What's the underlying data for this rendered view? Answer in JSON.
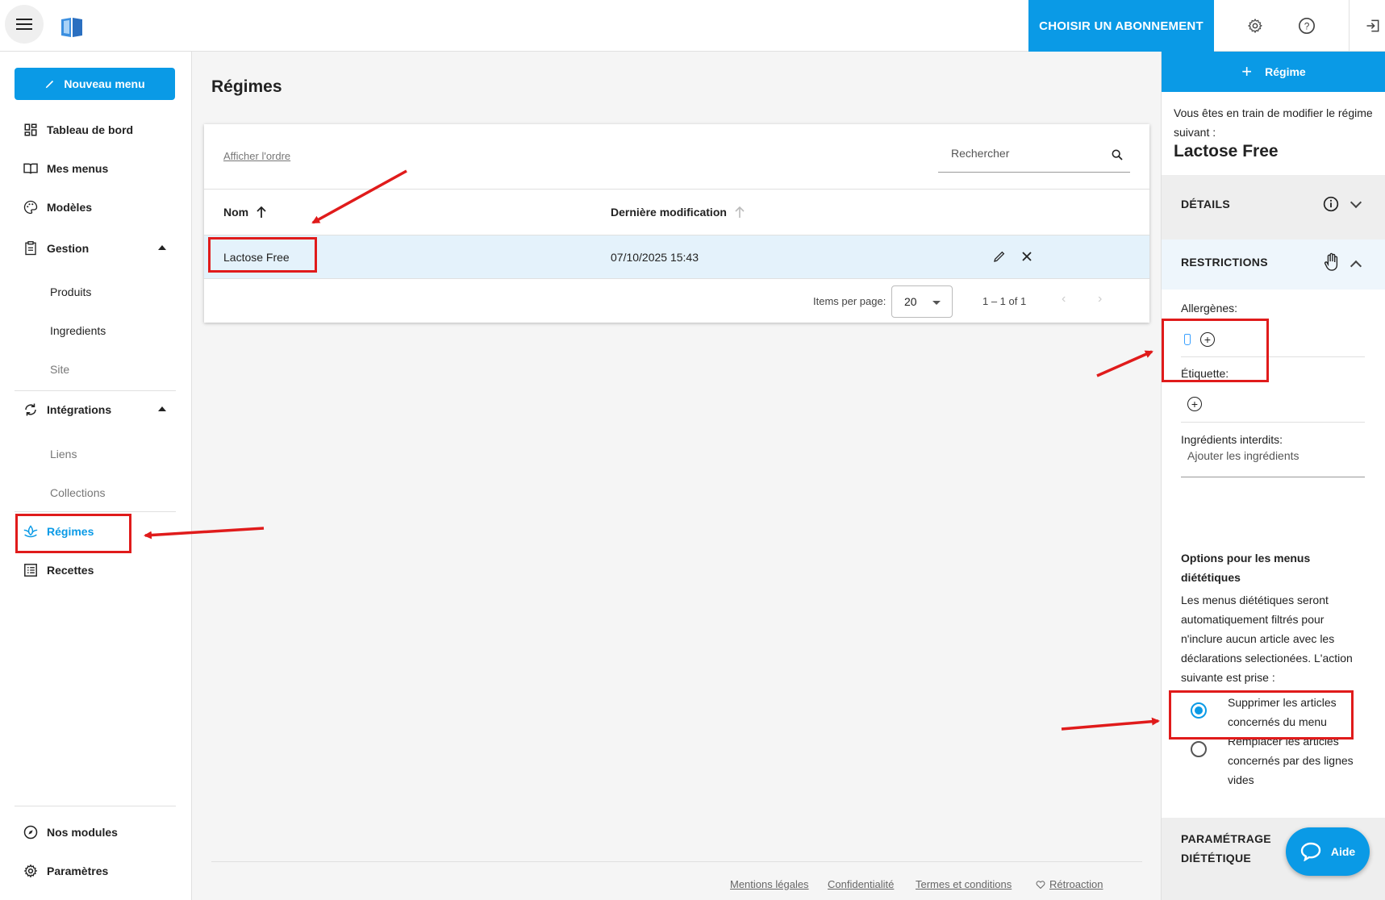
{
  "topbar": {
    "subscribe_label": "CHOISIR UN ABONNEMENT",
    "icons": [
      "menu-icon",
      "logo-book-icon",
      "settings-icon",
      "help-icon",
      "logout-icon"
    ]
  },
  "sidebar": {
    "new_menu_label": "Nouveau menu",
    "items": {
      "dashboard": "Tableau de bord",
      "my_menus": "Mes menus",
      "templates": "Modèles",
      "management": "Gestion",
      "products": "Produits",
      "ingredients": "Ingredients",
      "site": "Site",
      "integrations": "Intégrations",
      "links": "Liens",
      "collections": "Collections",
      "diets": "Régimes",
      "recipes": "Recettes",
      "modules": "Nos modules",
      "settings": "Paramètres"
    }
  },
  "main": {
    "title": "Régimes",
    "show_order_label": "Afficher l'ordre",
    "search_placeholder": "Rechercher",
    "columns": {
      "name": "Nom",
      "modified": "Dernière modification"
    },
    "rows": [
      {
        "name": "Lactose Free",
        "modified": "07/10/2025 15:43"
      }
    ],
    "paginator": {
      "items_per_page_label": "Items per page:",
      "page_size": "20",
      "range": "1 – 1 of 1"
    },
    "footer": {
      "legal": "Mentions légales",
      "privacy": "Confidentialité",
      "terms": "Termes et conditions",
      "feedback": "Rétroaction"
    }
  },
  "panel": {
    "header_label": "Régime",
    "intro": "Vous êtes en train de modifier le régime suivant :",
    "diet_name": "Lactose Free",
    "details_label": "DÉTAILS",
    "restrictions_label": "RESTRICTIONS",
    "allergens_label": "Allergènes:",
    "tag_label": "Étiquette:",
    "forbidden_label": "Ingrédients interdits:",
    "add_ingredients": "Ajouter les ingrédients",
    "options_title": "Options pour les menus diététiques",
    "options_desc": "Les menus diététiques seront automatiquement filtrés pour n'inclure aucun article avec les déclarations selectionées. L'action suivante est prise :",
    "option_remove": "Supprimer les articles concernés du menu",
    "option_replace": "Remplacer les articles concernés par des lignes vides",
    "selected_option": "remove",
    "param_label": "PARAMÉTRAGE DIÉTÉTIQUE"
  },
  "help_label": "Aide",
  "colors": {
    "accent": "#0a9ae6",
    "annotation": "#e01b1b",
    "selected_row": "#e4f2fb"
  }
}
